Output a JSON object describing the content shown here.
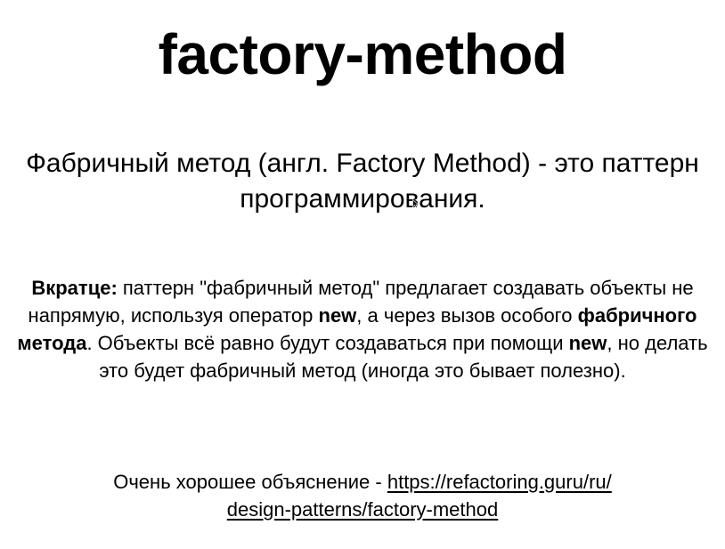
{
  "title": "factory-method",
  "subtitle": "Фабричный метод (англ. Factory Method) - это паттерн программирования.",
  "summary": {
    "lead": "Вкратце:",
    "part1": " паттерн \"фабричный метод\" предлагает создавать объекты не напрямую, используя оператор ",
    "kw1": "new",
    "part2": ", а через вызов особого ",
    "kw2": "фабричного метода",
    "part3": ". Объекты всё равно будут создаваться при помощи ",
    "kw3": "new",
    "part4": ", но делать это будет фабричный метод (иногда это бывает полезно)."
  },
  "explanation": {
    "text": "Очень хорошее объяснение - ",
    "link_line1": "https://refactoring.guru/ru/",
    "link_line2": "design-patterns/factory-method"
  }
}
